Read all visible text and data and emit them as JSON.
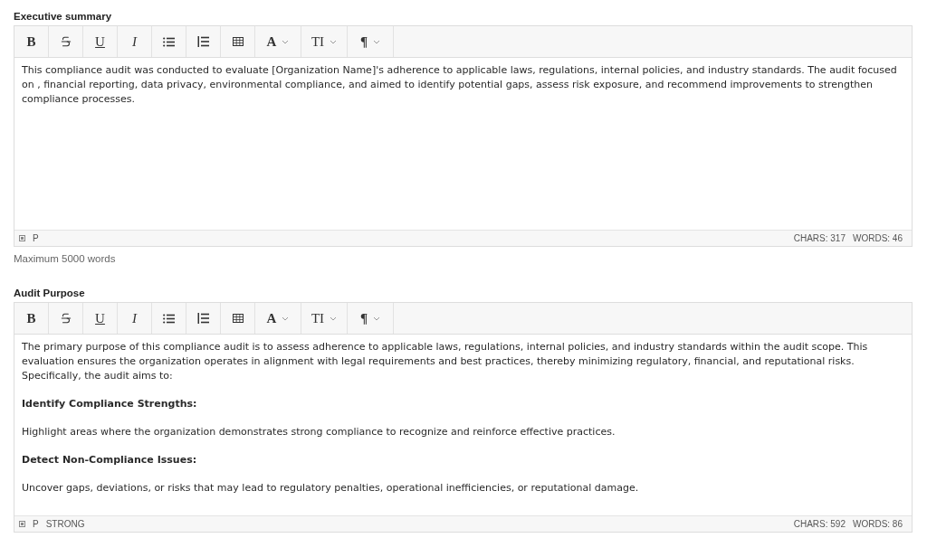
{
  "editors": [
    {
      "label": "Executive summary",
      "toolbar": [
        {
          "kind": "bold",
          "label": "B"
        },
        {
          "kind": "strike"
        },
        {
          "kind": "underline",
          "label": "U"
        },
        {
          "kind": "italic",
          "label": "I"
        },
        {
          "kind": "bullets"
        },
        {
          "kind": "numbers"
        },
        {
          "kind": "table"
        },
        {
          "kind": "color",
          "label": "A",
          "dropdown": true
        },
        {
          "kind": "size",
          "label": "TI",
          "dropdown": true
        },
        {
          "kind": "paragraph",
          "label": "¶",
          "dropdown": true
        }
      ],
      "content": [
        {
          "kind": "paragraph",
          "text": "This compliance audit was conducted to evaluate [Organization Name]'s adherence to applicable laws, regulations, internal policies, and industry standards. The audit focused on , financial reporting, data privacy, environmental compliance, and aimed to identify potential gaps, assess risk exposure, and recommend improvements to strengthen compliance processes."
        }
      ],
      "path": [
        "P"
      ],
      "chars": "CHARS: 317",
      "words": "WORDS: 46",
      "help": "Maximum 5000 words"
    },
    {
      "label": "Audit Purpose",
      "toolbar": [
        {
          "kind": "bold",
          "label": "B"
        },
        {
          "kind": "strike"
        },
        {
          "kind": "underline",
          "label": "U"
        },
        {
          "kind": "italic",
          "label": "I"
        },
        {
          "kind": "bullets"
        },
        {
          "kind": "numbers"
        },
        {
          "kind": "table"
        },
        {
          "kind": "color",
          "label": "A",
          "dropdown": true
        },
        {
          "kind": "size",
          "label": "TI",
          "dropdown": true
        },
        {
          "kind": "paragraph",
          "label": "¶",
          "dropdown": true
        }
      ],
      "content": [
        {
          "kind": "paragraph",
          "text": "The primary purpose of this compliance audit is to assess  adherence to applicable laws, regulations, internal policies, and industry standards within the audit scope. This evaluation ensures the organization operates in alignment with legal requirements and best practices, thereby minimizing regulatory, financial, and reputational risks. Specifically, the audit aims to:"
        },
        {
          "kind": "heading",
          "text": "Identify Compliance Strengths:"
        },
        {
          "kind": "paragraph",
          "text": "Highlight areas where the organization demonstrates strong compliance to recognize and reinforce effective practices."
        },
        {
          "kind": "heading",
          "text": "Detect Non-Compliance Issues:"
        },
        {
          "kind": "paragraph",
          "text": "Uncover gaps, deviations, or risks that may lead to regulatory penalties, operational inefficiencies, or reputational damage."
        }
      ],
      "path": [
        "P",
        "STRONG"
      ],
      "chars": "CHARS: 592",
      "words": "WORDS: 86"
    }
  ]
}
